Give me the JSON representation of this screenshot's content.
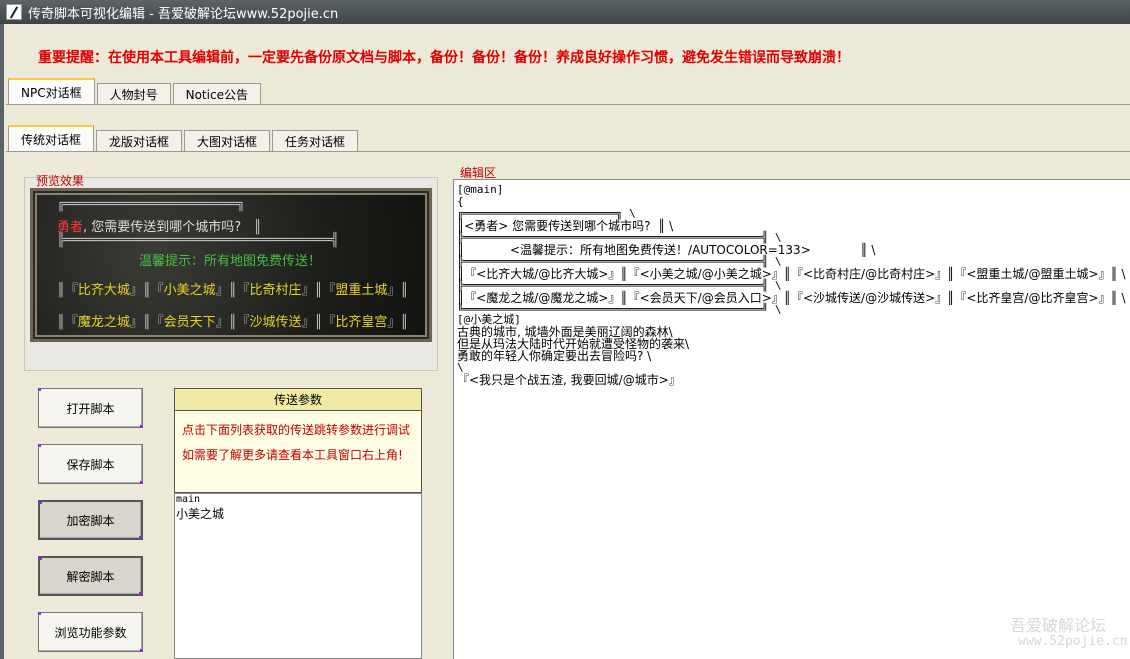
{
  "window": {
    "title": "传奇脚本可视化编辑 - 吾爱破解论坛www.52pojie.cn"
  },
  "warning": "重要提醒：在使用本工具编辑前，一定要先备份原文档与脚本，备份！备份！备份！养成良好操作习惯，避免发生错误而导致崩溃！",
  "tabs_top": [
    "NPC对话框",
    "人物封号",
    "Notice公告"
  ],
  "tabs_sub": [
    "传统对话框",
    "龙版对话框",
    "大图对话框",
    "任务对话框"
  ],
  "preview": {
    "label": "预览效果",
    "frame_top": "╔══════════════════════╗",
    "line1_hero": "勇者",
    "line1_rest": ", 您需要传送到哪个城市吗?",
    "line1_end": "║",
    "frame_mid": "╠══════════════════════════════════╣",
    "tip": "温馨提示：所有地图免费传送！",
    "row1": [
      "比齐大城",
      "小美之城",
      "比奇村庄",
      "盟重土城"
    ],
    "row2": [
      "魔龙之城",
      "会员天下",
      "沙城传送",
      "比齐皇宫"
    ]
  },
  "buttons": [
    "打开脚本",
    "保存脚本",
    "加密脚本",
    "解密脚本",
    "浏览功能参数"
  ],
  "params": {
    "title": "传送参数",
    "line1": "点击下面列表获取的传送跳转参数进行调试",
    "line2": "如需要了解更多请查看本工具窗口右上角!"
  },
  "output": {
    "line1": "main",
    "line2": "小美之城"
  },
  "editor": {
    "label": "编辑区",
    "lines": [
      "[@main]",
      "{",
      "╔═══════════════════════╗ \\",
      "║<勇者> 您需要传送到哪个城市吗?  ║ \\",
      "╠═════════════════════════════════════════════╣ \\",
      "║            <温馨提示：所有地图免费传送！/AUTOCOLOR=133>             ║ \\",
      "╠═════════════════════════════════════════════╣ \\",
      "║『<比齐大城/@比齐大城>』║『<小美之城/@小美之城>』║『<比奇村庄/@比奇村庄>』║『<盟重土城/@盟重土城>』║ \\",
      "╠═════════════════════════════════════════════╣ \\",
      "║『<魔龙之城/@魔龙之城>』║『<会员天下/@会员入口>』║『<沙城传送/@沙城传送>』║『<比齐皇宫/@比齐皇宫>』║ \\",
      "╚═════════════════════════════════════════════╝ \\",
      "",
      "[@小美之城]",
      "古典的城市, 城墙外面是美丽辽阔的森林\\",
      "但是从玛法大陆时代开始就遭受怪物的袭来\\",
      "勇敢的年轻人你确定要出去冒险吗? \\",
      "\\",
      "『<我只是个战五渣, 我要回城/@城市>』"
    ]
  },
  "watermark": {
    "line1": "吾爱破解论坛",
    "line2": "www.52pojie.cn"
  }
}
